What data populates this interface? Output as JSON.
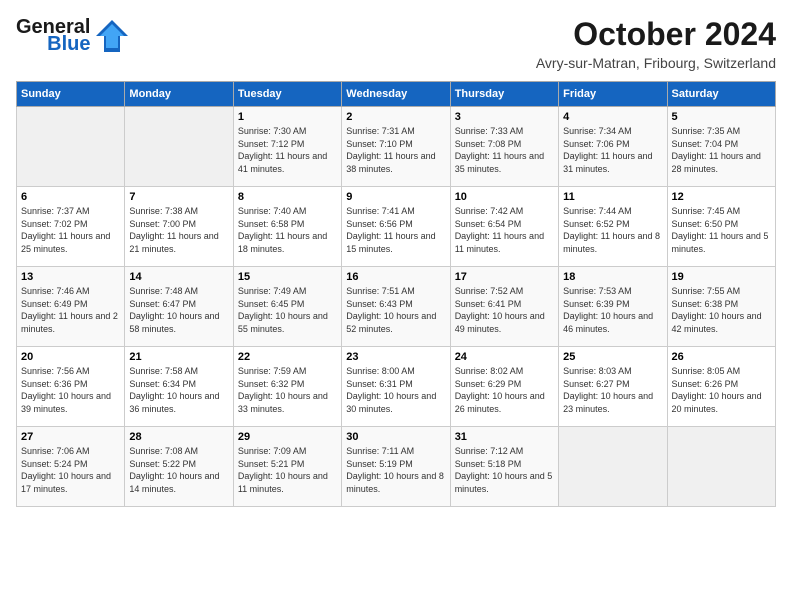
{
  "header": {
    "logo_line1": "General",
    "logo_line2": "Blue",
    "month": "October 2024",
    "location": "Avry-sur-Matran, Fribourg, Switzerland"
  },
  "days_of_week": [
    "Sunday",
    "Monday",
    "Tuesday",
    "Wednesday",
    "Thursday",
    "Friday",
    "Saturday"
  ],
  "weeks": [
    [
      {
        "num": "",
        "sunrise": "",
        "sunset": "",
        "daylight": ""
      },
      {
        "num": "",
        "sunrise": "",
        "sunset": "",
        "daylight": ""
      },
      {
        "num": "1",
        "sunrise": "Sunrise: 7:30 AM",
        "sunset": "Sunset: 7:12 PM",
        "daylight": "Daylight: 11 hours and 41 minutes."
      },
      {
        "num": "2",
        "sunrise": "Sunrise: 7:31 AM",
        "sunset": "Sunset: 7:10 PM",
        "daylight": "Daylight: 11 hours and 38 minutes."
      },
      {
        "num": "3",
        "sunrise": "Sunrise: 7:33 AM",
        "sunset": "Sunset: 7:08 PM",
        "daylight": "Daylight: 11 hours and 35 minutes."
      },
      {
        "num": "4",
        "sunrise": "Sunrise: 7:34 AM",
        "sunset": "Sunset: 7:06 PM",
        "daylight": "Daylight: 11 hours and 31 minutes."
      },
      {
        "num": "5",
        "sunrise": "Sunrise: 7:35 AM",
        "sunset": "Sunset: 7:04 PM",
        "daylight": "Daylight: 11 hours and 28 minutes."
      }
    ],
    [
      {
        "num": "6",
        "sunrise": "Sunrise: 7:37 AM",
        "sunset": "Sunset: 7:02 PM",
        "daylight": "Daylight: 11 hours and 25 minutes."
      },
      {
        "num": "7",
        "sunrise": "Sunrise: 7:38 AM",
        "sunset": "Sunset: 7:00 PM",
        "daylight": "Daylight: 11 hours and 21 minutes."
      },
      {
        "num": "8",
        "sunrise": "Sunrise: 7:40 AM",
        "sunset": "Sunset: 6:58 PM",
        "daylight": "Daylight: 11 hours and 18 minutes."
      },
      {
        "num": "9",
        "sunrise": "Sunrise: 7:41 AM",
        "sunset": "Sunset: 6:56 PM",
        "daylight": "Daylight: 11 hours and 15 minutes."
      },
      {
        "num": "10",
        "sunrise": "Sunrise: 7:42 AM",
        "sunset": "Sunset: 6:54 PM",
        "daylight": "Daylight: 11 hours and 11 minutes."
      },
      {
        "num": "11",
        "sunrise": "Sunrise: 7:44 AM",
        "sunset": "Sunset: 6:52 PM",
        "daylight": "Daylight: 11 hours and 8 minutes."
      },
      {
        "num": "12",
        "sunrise": "Sunrise: 7:45 AM",
        "sunset": "Sunset: 6:50 PM",
        "daylight": "Daylight: 11 hours and 5 minutes."
      }
    ],
    [
      {
        "num": "13",
        "sunrise": "Sunrise: 7:46 AM",
        "sunset": "Sunset: 6:49 PM",
        "daylight": "Daylight: 11 hours and 2 minutes."
      },
      {
        "num": "14",
        "sunrise": "Sunrise: 7:48 AM",
        "sunset": "Sunset: 6:47 PM",
        "daylight": "Daylight: 10 hours and 58 minutes."
      },
      {
        "num": "15",
        "sunrise": "Sunrise: 7:49 AM",
        "sunset": "Sunset: 6:45 PM",
        "daylight": "Daylight: 10 hours and 55 minutes."
      },
      {
        "num": "16",
        "sunrise": "Sunrise: 7:51 AM",
        "sunset": "Sunset: 6:43 PM",
        "daylight": "Daylight: 10 hours and 52 minutes."
      },
      {
        "num": "17",
        "sunrise": "Sunrise: 7:52 AM",
        "sunset": "Sunset: 6:41 PM",
        "daylight": "Daylight: 10 hours and 49 minutes."
      },
      {
        "num": "18",
        "sunrise": "Sunrise: 7:53 AM",
        "sunset": "Sunset: 6:39 PM",
        "daylight": "Daylight: 10 hours and 46 minutes."
      },
      {
        "num": "19",
        "sunrise": "Sunrise: 7:55 AM",
        "sunset": "Sunset: 6:38 PM",
        "daylight": "Daylight: 10 hours and 42 minutes."
      }
    ],
    [
      {
        "num": "20",
        "sunrise": "Sunrise: 7:56 AM",
        "sunset": "Sunset: 6:36 PM",
        "daylight": "Daylight: 10 hours and 39 minutes."
      },
      {
        "num": "21",
        "sunrise": "Sunrise: 7:58 AM",
        "sunset": "Sunset: 6:34 PM",
        "daylight": "Daylight: 10 hours and 36 minutes."
      },
      {
        "num": "22",
        "sunrise": "Sunrise: 7:59 AM",
        "sunset": "Sunset: 6:32 PM",
        "daylight": "Daylight: 10 hours and 33 minutes."
      },
      {
        "num": "23",
        "sunrise": "Sunrise: 8:00 AM",
        "sunset": "Sunset: 6:31 PM",
        "daylight": "Daylight: 10 hours and 30 minutes."
      },
      {
        "num": "24",
        "sunrise": "Sunrise: 8:02 AM",
        "sunset": "Sunset: 6:29 PM",
        "daylight": "Daylight: 10 hours and 26 minutes."
      },
      {
        "num": "25",
        "sunrise": "Sunrise: 8:03 AM",
        "sunset": "Sunset: 6:27 PM",
        "daylight": "Daylight: 10 hours and 23 minutes."
      },
      {
        "num": "26",
        "sunrise": "Sunrise: 8:05 AM",
        "sunset": "Sunset: 6:26 PM",
        "daylight": "Daylight: 10 hours and 20 minutes."
      }
    ],
    [
      {
        "num": "27",
        "sunrise": "Sunrise: 7:06 AM",
        "sunset": "Sunset: 5:24 PM",
        "daylight": "Daylight: 10 hours and 17 minutes."
      },
      {
        "num": "28",
        "sunrise": "Sunrise: 7:08 AM",
        "sunset": "Sunset: 5:22 PM",
        "daylight": "Daylight: 10 hours and 14 minutes."
      },
      {
        "num": "29",
        "sunrise": "Sunrise: 7:09 AM",
        "sunset": "Sunset: 5:21 PM",
        "daylight": "Daylight: 10 hours and 11 minutes."
      },
      {
        "num": "30",
        "sunrise": "Sunrise: 7:11 AM",
        "sunset": "Sunset: 5:19 PM",
        "daylight": "Daylight: 10 hours and 8 minutes."
      },
      {
        "num": "31",
        "sunrise": "Sunrise: 7:12 AM",
        "sunset": "Sunset: 5:18 PM",
        "daylight": "Daylight: 10 hours and 5 minutes."
      },
      {
        "num": "",
        "sunrise": "",
        "sunset": "",
        "daylight": ""
      },
      {
        "num": "",
        "sunrise": "",
        "sunset": "",
        "daylight": ""
      }
    ]
  ]
}
